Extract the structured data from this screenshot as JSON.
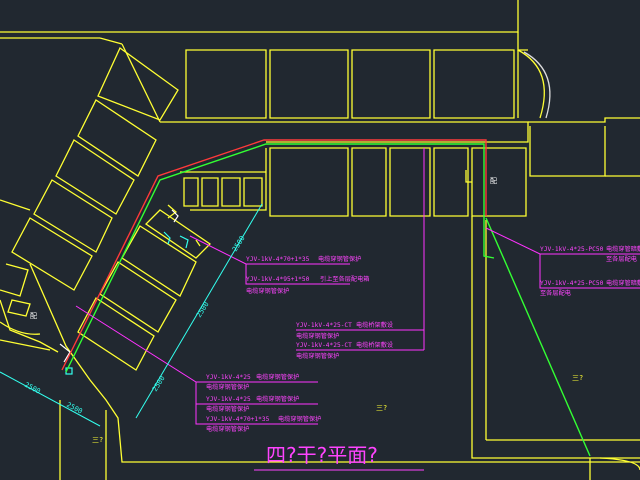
{
  "drawing": {
    "title": "四?干?平面?",
    "colors": {
      "background": "#212830",
      "walls": "#ffff33",
      "cable_red": "#ff3a3a",
      "cable_green": "#33ff33",
      "leader_magenta": "#ff33ff",
      "dimension_cyan": "#33ffee",
      "room_label": "#ffffff"
    }
  },
  "labels": {
    "cable_a_line1": "YJV-1kV-4*70+1*35",
    "cable_a_note": "电缆穿钢管保护",
    "cable_a_line2": "YJV-1kV-4*95+1*50",
    "cable_a_note2": "引上至各层配电箱",
    "cable_b_line1": "YJV-1kV-4*25-CT",
    "cable_b_note1": "电缆桥架敷设",
    "cable_b_sub1": "电缆穿钢管保护",
    "cable_b_line2": "YJV-1kV-4*25-CT",
    "cable_b_note2": "电缆桥架敷设",
    "cable_b_sub2": "电缆穿钢管保护",
    "cable_c_line1": "YJV-1kV-4*25",
    "cable_c_note1": "电缆穿钢管保护",
    "cable_c_sub1": "电缆穿钢管保护",
    "cable_c_line2": "YJV-1kV-4*25",
    "cable_c_note2": "电缆穿钢管保护",
    "cable_c_sub2": "电缆穿钢管保护",
    "cable_c_line3": "YJV-1kV-4*70+1*35",
    "cable_c_note3": "电缆穿钢管保护",
    "cable_c_sub3": "电缆穿钢管保护",
    "cable_d_line1": "YJV-1kV-4*25-PC50",
    "cable_d_note1": "电缆穿管暗敷",
    "cable_d_sub1": "至各层配电",
    "cable_d_line2": "YJV-1kV-4*25-PC50",
    "cable_d_note2": "电缆穿管暗敷",
    "cable_d_sub2": "至各层配电",
    "room_1": "配",
    "room_2": "配",
    "room_3": "三?",
    "room_4": "三?",
    "room_5": "三?",
    "dim_1": "2500",
    "dim_2": "2500",
    "dim_3": "2500",
    "dim_4": "2500",
    "dim_5": "2500"
  }
}
